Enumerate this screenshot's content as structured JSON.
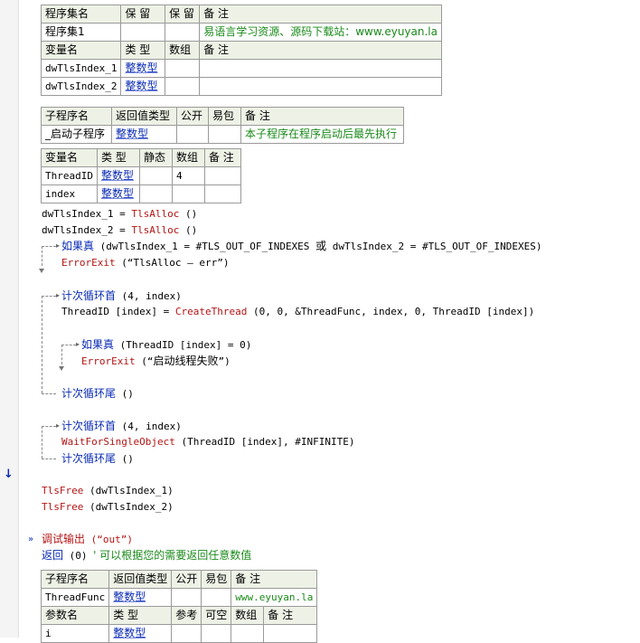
{
  "assembly_table": {
    "headers": [
      "程序集名",
      "保 留",
      "保 留",
      "备 注"
    ],
    "row": [
      "程序集1",
      "",
      "",
      "易语言学习资源、源码下载站：www.eyuyan.la"
    ],
    "var_headers": [
      "变量名",
      "类 型",
      "数组",
      "备 注"
    ],
    "vars": [
      [
        "dwTlsIndex_1",
        "整数型",
        "",
        ""
      ],
      [
        "dwTlsIndex_2",
        "整数型",
        "",
        ""
      ]
    ]
  },
  "sub1_table": {
    "headers": [
      "子程序名",
      "返回值类型",
      "公开",
      "易包",
      "备 注"
    ],
    "row": [
      "_启动子程序",
      "整数型",
      "",
      "",
      "本子程序在程序启动后最先执行"
    ]
  },
  "sub1_vars": {
    "headers": [
      "变量名",
      "类 型",
      "静态",
      "数组",
      "备 注"
    ],
    "rows": [
      [
        "ThreadID",
        "整数型",
        "",
        "4",
        ""
      ],
      [
        "index",
        "整数型",
        "",
        "",
        ""
      ]
    ]
  },
  "code": {
    "l1a": "dwTlsIndex_1 = ",
    "l1b": "TlsAlloc",
    "l1c": " ()",
    "l2a": "dwTlsIndex_2 = ",
    "l2b": "TlsAlloc",
    "l2c": " ()",
    "l3kw": "如果真",
    "l3rest": " (dwTlsIndex_1 = #TLS_OUT_OF_INDEXES ",
    "l3or": "或",
    "l3rest2": " dwTlsIndex_2 = #TLS_OUT_OF_INDEXES)",
    "l4fn": "ErrorExit",
    "l4rest": " (“TlsAlloc — err”)",
    "l5kw": "计次循环首",
    "l5rest": " (4, index)",
    "l6a": "ThreadID [index] = ",
    "l6fn": "CreateThread",
    "l6rest": " (0, 0, &ThreadFunc, index, 0, ThreadID [index])",
    "l7kw": "如果真",
    "l7rest": " (ThreadID [index] = 0)",
    "l8fn": "ErrorExit",
    "l8o": " (“",
    "l8s": "启动线程失败",
    "l8c": "”)",
    "l9kw": "计次循环尾",
    "l9rest": " ()",
    "l10kw": "计次循环首",
    "l10rest": " (4, index)",
    "l11fn": "WaitForSingleObject",
    "l11rest": " (ThreadID [index], #INFINITE)",
    "l12kw": "计次循环尾",
    "l12rest": " ()",
    "l13fn": "TlsFree",
    "l13rest": " (dwTlsIndex_1)",
    "l14fn": "TlsFree",
    "l14rest": " (dwTlsIndex_2)",
    "l15kw": "调试输出",
    "l15rest": " (“out”)",
    "l16kw": "返回",
    "l16rest": " (0)  ",
    "l16cm": "' 可以根据您的需要返回任意数值"
  },
  "sub2_table": {
    "headers": [
      "子程序名",
      "返回值类型",
      "公开",
      "易包",
      "备 注"
    ],
    "row": [
      "ThreadFunc",
      "整数型",
      "",
      "",
      "www.eyuyan.la"
    ],
    "param_headers": [
      "参数名",
      "类 型",
      "参考",
      "可空",
      "数组",
      "备 注"
    ],
    "param_row": [
      "i",
      "整数型",
      "",
      "",
      "",
      ""
    ]
  },
  "colors": {
    "keyword": "#0a2bb4",
    "function": "#b41414",
    "comment": "#1a8a1a",
    "header_bg": "#eef2e6"
  },
  "icons": {
    "breakpoint": "down-arrow-icon",
    "current_line": "double-chevron-icon"
  }
}
